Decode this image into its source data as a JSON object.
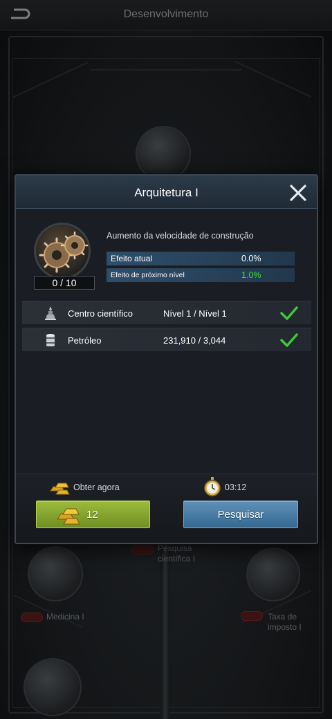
{
  "header": {
    "title": "Desenvolvimento"
  },
  "background": {
    "nodes": [
      {
        "label": "Pesquisa científica I"
      },
      {
        "label": "Medicina I"
      },
      {
        "label": "Taxa de imposto I"
      }
    ]
  },
  "modal": {
    "title": "Arquitetura I",
    "progress": "0 / 10",
    "description": "Aumento da velocidade de construção",
    "stats": [
      {
        "label": "Efeito atual",
        "value": "0.0%"
      },
      {
        "label": "Efeito de próximo nível",
        "value": "1.0%"
      }
    ],
    "requirements": [
      {
        "icon": "science-center-icon",
        "name": "Centro científico",
        "value": "Nível 1 / Nível 1",
        "met": true
      },
      {
        "icon": "oil-barrel-icon",
        "name": "Petróleo",
        "value": "231,910 / 3,044",
        "met": true
      }
    ],
    "footer": {
      "obter_label": "Obter agora",
      "timer": "03:12",
      "gold_cost": "12",
      "research_label": "Pesquisar"
    }
  },
  "colors": {
    "accent_green": "#3ce03a",
    "gold_button": "#8aab32",
    "research_button": "#4a7fa8"
  }
}
